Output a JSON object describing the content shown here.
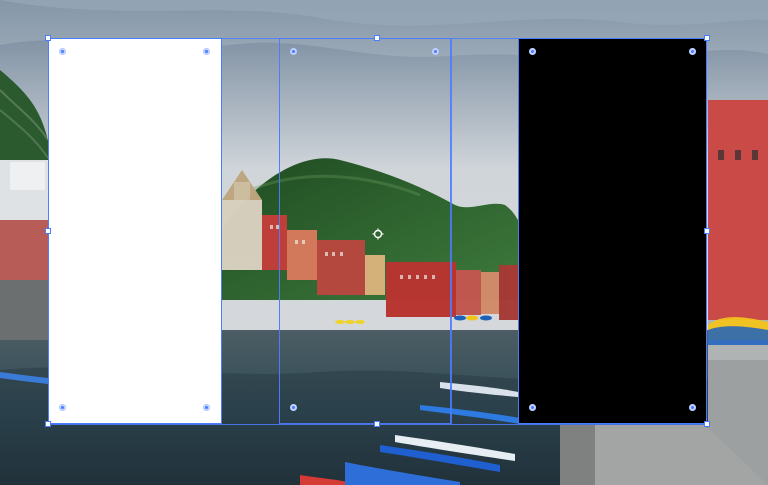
{
  "canvas": {
    "name": "design-canvas"
  },
  "layers": [
    {
      "name": "white-rectangle"
    },
    {
      "name": "black-rectangle"
    },
    {
      "name": "middle-frame"
    }
  ],
  "icons": {
    "crosshair": "crosshair-icon"
  }
}
